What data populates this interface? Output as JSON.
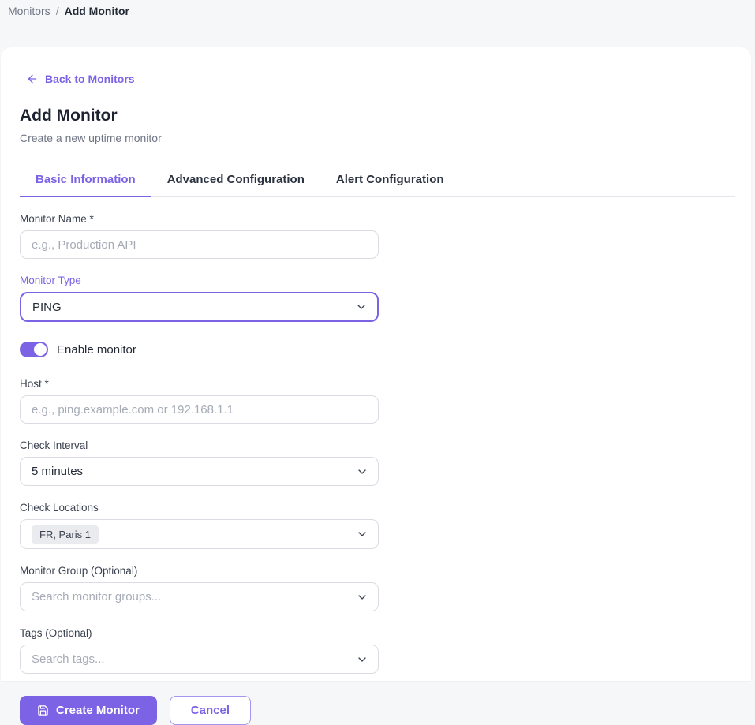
{
  "colors": {
    "accent": "#7c63e6",
    "page_background": "#f6f7f9",
    "card_background": "#ffffff",
    "input_border": "#d9dce3",
    "chip_background": "#e9ebee"
  },
  "breadcrumb": {
    "parent": "Monitors",
    "separator": "/",
    "current": "Add Monitor"
  },
  "header": {
    "back_link": "Back to Monitors",
    "title": "Add Monitor",
    "subtitle": "Create a new uptime monitor"
  },
  "tabs": [
    {
      "label": "Basic Information",
      "active": true
    },
    {
      "label": "Advanced Configuration",
      "active": false
    },
    {
      "label": "Alert Configuration",
      "active": false
    }
  ],
  "form": {
    "monitor_name": {
      "label": "Monitor Name *",
      "placeholder": "e.g., Production API",
      "value": ""
    },
    "monitor_type": {
      "label": "Monitor Type",
      "value": "PING",
      "focused": true
    },
    "enable_monitor": {
      "label": "Enable monitor",
      "enabled": true
    },
    "host": {
      "label": "Host *",
      "placeholder": "e.g., ping.example.com or 192.168.1.1",
      "value": ""
    },
    "check_interval": {
      "label": "Check Interval",
      "value": "5 minutes"
    },
    "check_locations": {
      "label": "Check Locations",
      "selected_chip": "FR, Paris 1"
    },
    "monitor_group": {
      "label": "Monitor Group (Optional)",
      "placeholder": "Search monitor groups..."
    },
    "tags": {
      "label": "Tags (Optional)",
      "placeholder": "Search tags..."
    }
  },
  "actions": {
    "create_label": "Create Monitor",
    "cancel_label": "Cancel"
  },
  "icons": {
    "back": "arrow-left-icon",
    "dropdown": "chevron-down-icon",
    "save": "save-icon"
  }
}
